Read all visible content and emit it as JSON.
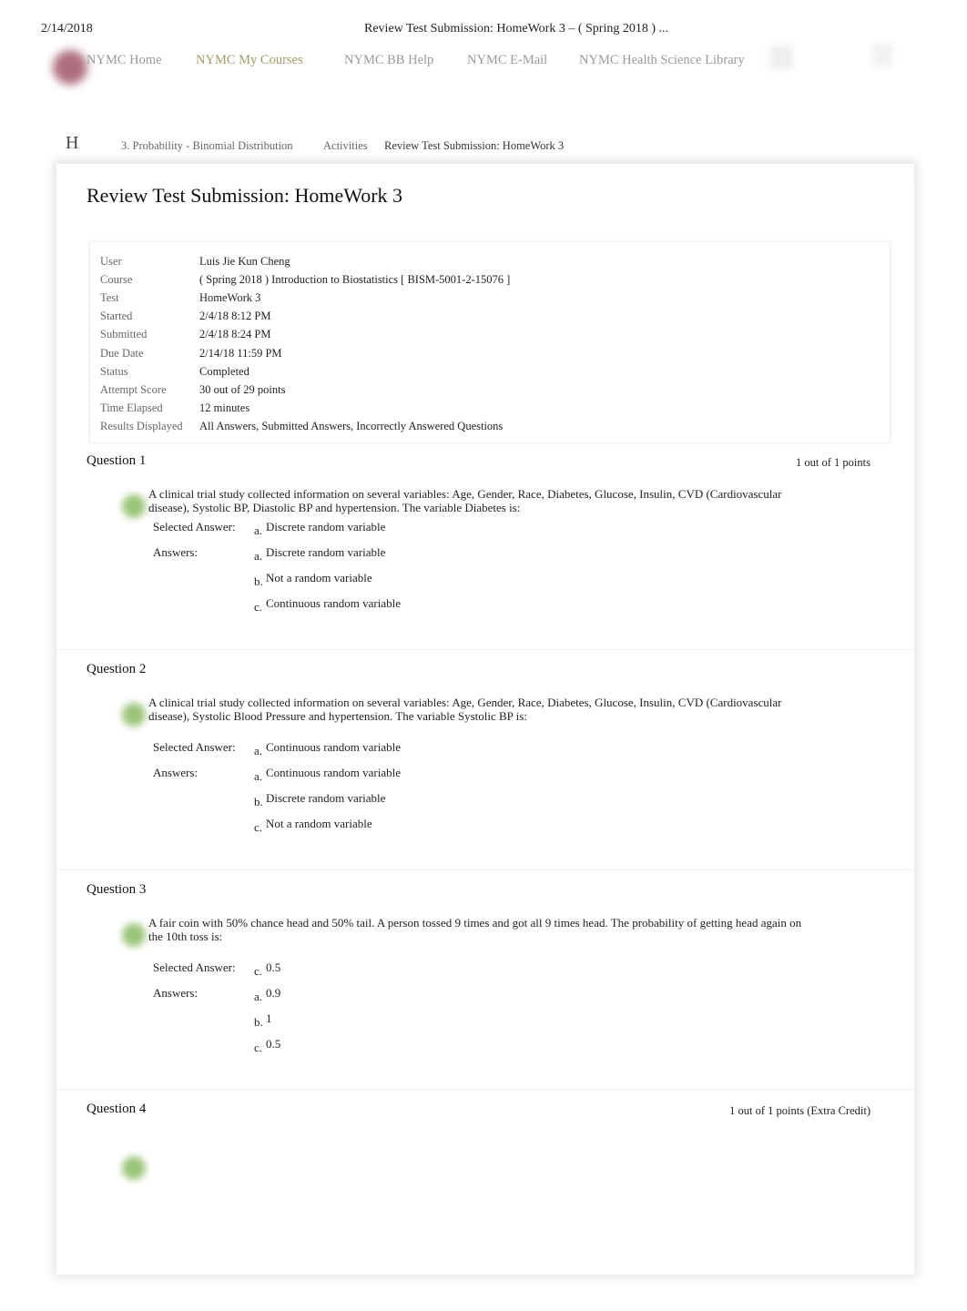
{
  "header": {
    "date": "2/14/2018",
    "page_title": "Review Test Submission: HomeWork 3 – ( Spring 2018 ) ..."
  },
  "nav": [
    "NYMC Home",
    "NYMC My Courses",
    "NYMC BB Help",
    "NYMC E-Mail",
    "NYMC Health Science Library"
  ],
  "breadcrumb": {
    "home_icon": "H",
    "items": [
      "3. Probability - Binomial Distribution",
      "Activities",
      "Review Test Submission: HomeWork 3"
    ]
  },
  "title": "Review Test Submission: HomeWork 3",
  "summary": [
    {
      "label": "User",
      "value": "Luis Jie Kun Cheng"
    },
    {
      "label": "Course",
      "value": "( Spring 2018 ) Introduction to Biostatistics [ BISM-5001-2-15076 ]"
    },
    {
      "label": "Test",
      "value": "HomeWork 3"
    },
    {
      "label": "Started",
      "value": "2/4/18 8:12 PM"
    },
    {
      "label": "Submitted",
      "value": "2/4/18 8:24 PM"
    },
    {
      "label": "Due Date",
      "value": "2/14/18 11:59 PM"
    },
    {
      "label": "Status",
      "value": "Completed"
    },
    {
      "label": "Attempt Score",
      "value": "30 out of 29 points"
    },
    {
      "label": "Time Elapsed",
      "value": "12 minutes"
    },
    {
      "label": "Results Displayed",
      "value": "All Answers, Submitted Answers, Incorrectly Answered Questions"
    }
  ],
  "labels": {
    "selected": "Selected Answer:",
    "answers": "Answers:"
  },
  "questions": [
    {
      "title": "Question 1",
      "points": "1 out of 1 points",
      "text": "A clinical trial study collected information on several variables: Age, Gender, Race, Diabetes, Glucose, Insulin, CVD (Cardiovascular disease), Systolic BP, Diastolic BP and hypertension. The variable Diabetes is:",
      "selected": {
        "letter": "a.",
        "text": "Discrete random variable"
      },
      "answers": [
        {
          "letter": "a.",
          "text": "Discrete random variable"
        },
        {
          "letter": "b.",
          "text": "Not a random variable"
        },
        {
          "letter": "c.",
          "text": "Continuous random variable"
        }
      ]
    },
    {
      "title": "Question 2",
      "points": "",
      "text": "A clinical trial study collected information on several variables: Age, Gender, Race, Diabetes, Glucose, Insulin, CVD (Cardiovascular disease), Systolic Blood Pressure and hypertension. The variable Systolic BP is:",
      "selected": {
        "letter": "a.",
        "text": "Continuous random variable"
      },
      "answers": [
        {
          "letter": "a.",
          "text": "Continuous random variable"
        },
        {
          "letter": "b.",
          "text": "Discrete random variable"
        },
        {
          "letter": "c.",
          "text": "Not a random variable"
        }
      ]
    },
    {
      "title": "Question 3",
      "points": "",
      "text": "A fair coin with 50% chance head and 50% tail. A person tossed 9 times and got all 9 times head. The probability of getting head again on the 10th toss is:",
      "selected": {
        "letter": "c.",
        "text": "0.5"
      },
      "answers": [
        {
          "letter": "a.",
          "text": "0.9"
        },
        {
          "letter": "b.",
          "text": "1"
        },
        {
          "letter": "c.",
          "text": "0.5"
        }
      ]
    },
    {
      "title": "Question 4",
      "points": "1 out of 1 points (Extra Credit)"
    }
  ],
  "colors": {
    "nav_active": "#a39a6a",
    "nav": "#999999",
    "correct_icon": "#9cc47a"
  }
}
